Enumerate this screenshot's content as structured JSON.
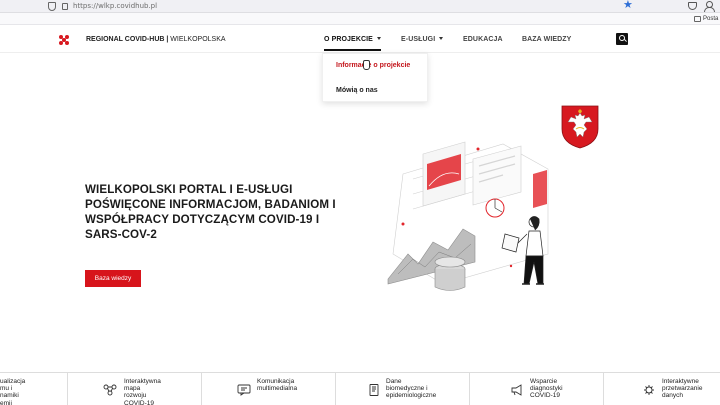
{
  "browser": {
    "url": "https://wlkp.covidhub.pl",
    "bookmarks_folder": "Posta"
  },
  "header": {
    "site_name_bold": "REGIONAL COVID-HUB |",
    "site_name_region": "WIELKOPOLSKA",
    "nav": [
      {
        "label": "O PROJEKCIE",
        "has_caret": true,
        "active": true
      },
      {
        "label": "E-USŁUGI",
        "has_caret": true,
        "active": false
      },
      {
        "label": "EDUKACJA",
        "has_caret": false,
        "active": false
      },
      {
        "label": "BAZA WIEDZY",
        "has_caret": false,
        "active": false
      }
    ],
    "search_icon": "search-icon"
  },
  "dropdown": {
    "items": [
      {
        "label": "Informacje o projekcie",
        "highlighted": true
      },
      {
        "label": "Mówią o nas",
        "highlighted": false
      }
    ]
  },
  "hero": {
    "title": "WIELKOPOLSKI PORTAL I E-USŁUGI POŚWIĘCONE INFORMACJOM, BADANIOM I WSPÓŁPRACY DOTYCZĄCYM COVID-19 I SARS-COV-2",
    "button_label": "Baza wiedzy"
  },
  "features": [
    {
      "label": "ualizacja\nmu i\nnamiki\nemii",
      "icon": "chart-icon"
    },
    {
      "label": "Interaktywna\nmapa\nrozwoju\nCOVID-19",
      "icon": "network-map-icon"
    },
    {
      "label": "Komunikacja\nmultimedialna",
      "icon": "chat-screen-icon"
    },
    {
      "label": "Dane\nbiomedyczne i\nepidemiologiczne",
      "icon": "document-icon"
    },
    {
      "label": "Wsparcie\ndiagnostyki\nCOVID-19",
      "icon": "megaphone-icon"
    },
    {
      "label": "Interaktywne\nprzetwarzanie\ndanych",
      "icon": "virus-icon"
    }
  ],
  "colors": {
    "accent_red": "#d7141b",
    "link_red": "#c4161c"
  }
}
